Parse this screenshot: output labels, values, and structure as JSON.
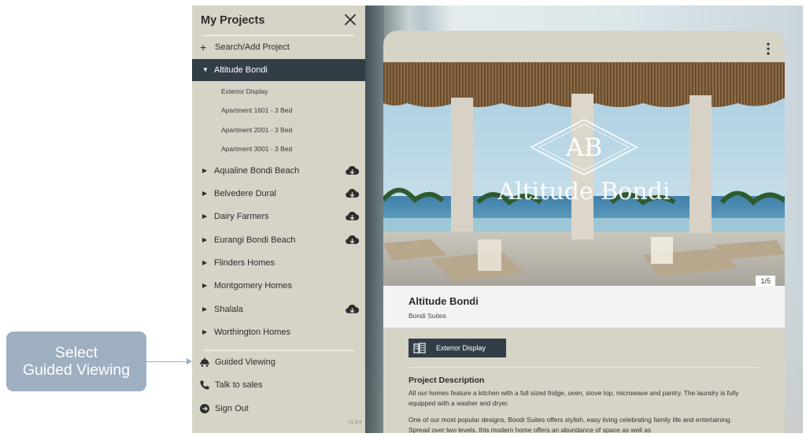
{
  "callout": {
    "line1": "Select",
    "line2": "Guided Viewing"
  },
  "sidebar": {
    "title": "My Projects",
    "search_add": "Search/Add Project",
    "active_project": "Altitude Bondi",
    "sub_items": [
      "Exterior Display",
      "Apartment 1601 - 3 Bed",
      "Apartment 2001 - 3 Bed",
      "Apartment 3001 - 3 Bed"
    ],
    "projects": [
      {
        "label": "Aqualine Bondi Beach",
        "cloud": true
      },
      {
        "label": "Belvedere Dural",
        "cloud": true
      },
      {
        "label": "Dairy Farmers",
        "cloud": true
      },
      {
        "label": "Eurangi Bondi Beach",
        "cloud": true
      },
      {
        "label": "Flinders Homes",
        "cloud": false
      },
      {
        "label": "Montgomery Homes",
        "cloud": false
      },
      {
        "label": "Shalala",
        "cloud": true
      },
      {
        "label": "Worthington Homes",
        "cloud": false
      }
    ],
    "footer": {
      "guided_viewing": "Guided Viewing",
      "talk_to_sales": "Talk to sales",
      "sign_out": "Sign Out"
    },
    "version": "v1.9.4"
  },
  "card": {
    "hero": {
      "monogram": "AB",
      "brand": "Altitude Bondi"
    },
    "pager": "1/5",
    "project_name": "Altitude Bondi",
    "project_subtitle": "Bondi Suites",
    "exterior_button": "Exterior Display",
    "description_title": "Project Description",
    "description_p1": "All our homes feature a kitchen with a full sized fridge, oven, stove top, microwave and pantry. The laundry is fully equipped with a washer and dryer.",
    "description_p2": "One of our most popular designs, Bondi Suites offers stylish, easy living celebrating family life and entertaining. Spread over two levels, this modern home offers an abundance of space as well as"
  },
  "colors": {
    "sidebar_bg": "#d6d3c7",
    "active_bg": "#323e46",
    "callout_bg": "#9dafc0",
    "info_bg": "#f3f3f3"
  },
  "icons": {
    "close": "close-icon",
    "plus": "plus-icon",
    "cloud": "cloud-download-icon",
    "guided": "guided-viewing-icon",
    "phone": "phone-icon",
    "signout": "sign-out-icon",
    "menu": "more-vertical-icon",
    "building": "building-icon"
  }
}
